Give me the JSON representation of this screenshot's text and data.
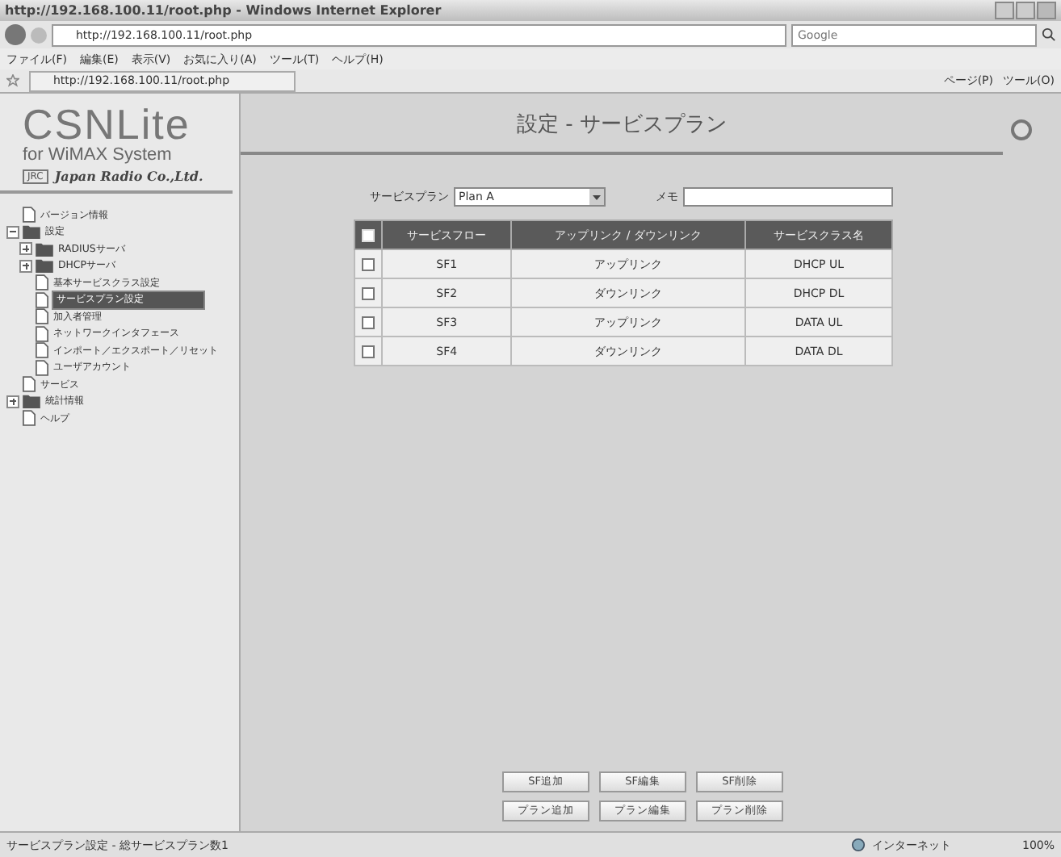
{
  "browser": {
    "title": "http://192.168.100.11/root.php - Windows Internet Explorer",
    "address": "http://192.168.100.11/root.php",
    "search_placeholder": "Google",
    "menus": [
      "ファイル(F)",
      "編集(E)",
      "表示(V)",
      "お気に入り(A)",
      "ツール(T)",
      "ヘルプ(H)"
    ],
    "tab_title": "http://192.168.100.11/root.php",
    "toolbar_items": [
      "ページ(P)",
      "ツール(O)"
    ]
  },
  "sidebar": {
    "logo_title": "CSNLite",
    "logo_subtitle": "for WiMAX System",
    "company_badge": "JRC",
    "company": "Japan Radio Co.,Ltd.",
    "tree": [
      {
        "label": "バージョン情報",
        "kind": "page",
        "selected": false
      },
      {
        "label": "設定",
        "kind": "folder",
        "expanded": true,
        "selected": false,
        "children": [
          {
            "label": "RADIUSサーバ",
            "kind": "folder",
            "expanded": false,
            "selected": false
          },
          {
            "label": "DHCPサーバ",
            "kind": "folder",
            "expanded": false,
            "selected": false
          },
          {
            "label": "基本サービスクラス設定",
            "kind": "page",
            "selected": false
          },
          {
            "label": "サービスプラン設定",
            "kind": "page",
            "selected": true
          },
          {
            "label": "加入者管理",
            "kind": "page",
            "selected": false
          },
          {
            "label": "ネットワークインタフェース",
            "kind": "page",
            "selected": false
          },
          {
            "label": "インポート／エクスポート／リセット",
            "kind": "page",
            "selected": false
          },
          {
            "label": "ユーザアカウント",
            "kind": "page",
            "selected": false
          }
        ]
      },
      {
        "label": "サービス",
        "kind": "page",
        "selected": false
      },
      {
        "label": "統計情報",
        "kind": "folder",
        "expanded": false,
        "selected": false
      },
      {
        "label": "ヘルプ",
        "kind": "page",
        "selected": false
      }
    ]
  },
  "main": {
    "title": "設定 - サービスプラン",
    "plan_label": "サービスプラン",
    "plan_value": "Plan A",
    "memo_label": "メモ",
    "table": {
      "header_checked": false,
      "columns": [
        "サービスフロー",
        "アップリンク / ダウンリンク",
        "サービスクラス名"
      ],
      "rows": [
        {
          "checked": false,
          "cells": [
            "SF1",
            "アップリンク",
            "DHCP UL"
          ]
        },
        {
          "checked": false,
          "cells": [
            "SF2",
            "ダウンリンク",
            "DHCP DL"
          ]
        },
        {
          "checked": false,
          "cells": [
            "SF3",
            "アップリンク",
            "DATA UL"
          ]
        },
        {
          "checked": false,
          "cells": [
            "SF4",
            "ダウンリンク",
            "DATA DL"
          ]
        }
      ]
    },
    "button_rows": [
      [
        "SF追加",
        "SF編集",
        "SF削除"
      ],
      [
        "プラン追加",
        "プラン編集",
        "プラン削除"
      ]
    ]
  },
  "status_bar": {
    "text": "サービスプラン設定 - 総サービスプラン数1",
    "zone": "インターネット",
    "zoom": "100%"
  }
}
